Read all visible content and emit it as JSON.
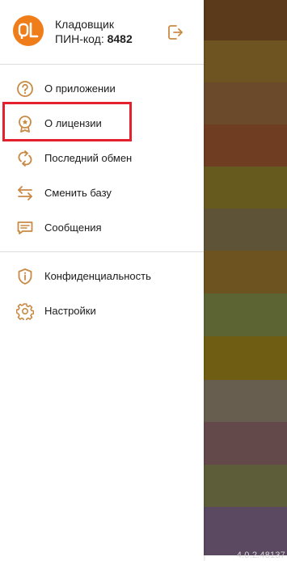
{
  "drawer": {
    "user_name": "Кладовщик",
    "pin_label": "ПИН-код:",
    "pin_value": "8482",
    "logo_text": "DL",
    "menu": [
      {
        "label": "О приложении",
        "icon": "question-circle-icon"
      },
      {
        "label": "О лицензии",
        "icon": "license-badge-icon",
        "highlighted": true
      },
      {
        "label": "Последний обмен",
        "icon": "sync-icon"
      },
      {
        "label": "Сменить базу",
        "icon": "swap-arrows-icon"
      },
      {
        "label": "Сообщения",
        "icon": "message-icon"
      }
    ],
    "menu2": [
      {
        "label": "Конфиденциальность",
        "icon": "shield-info-icon"
      },
      {
        "label": "Настройки",
        "icon": "gear-icon"
      }
    ]
  },
  "backdrop": {
    "stripes": [
      "#5b3a1c",
      "#6e5420",
      "#6b4a2c",
      "#6f3e22",
      "#675a1f",
      "#5e5336",
      "#6d531f",
      "#5c6434",
      "#6f5d14",
      "#675e50",
      "#64494b",
      "#5e5d3a",
      "#5a4960"
    ]
  },
  "version": "4.0.2.48137",
  "colors": {
    "accent": "#ef7d1a",
    "icon": "#c98a45",
    "highlight_border": "#e3202c"
  }
}
